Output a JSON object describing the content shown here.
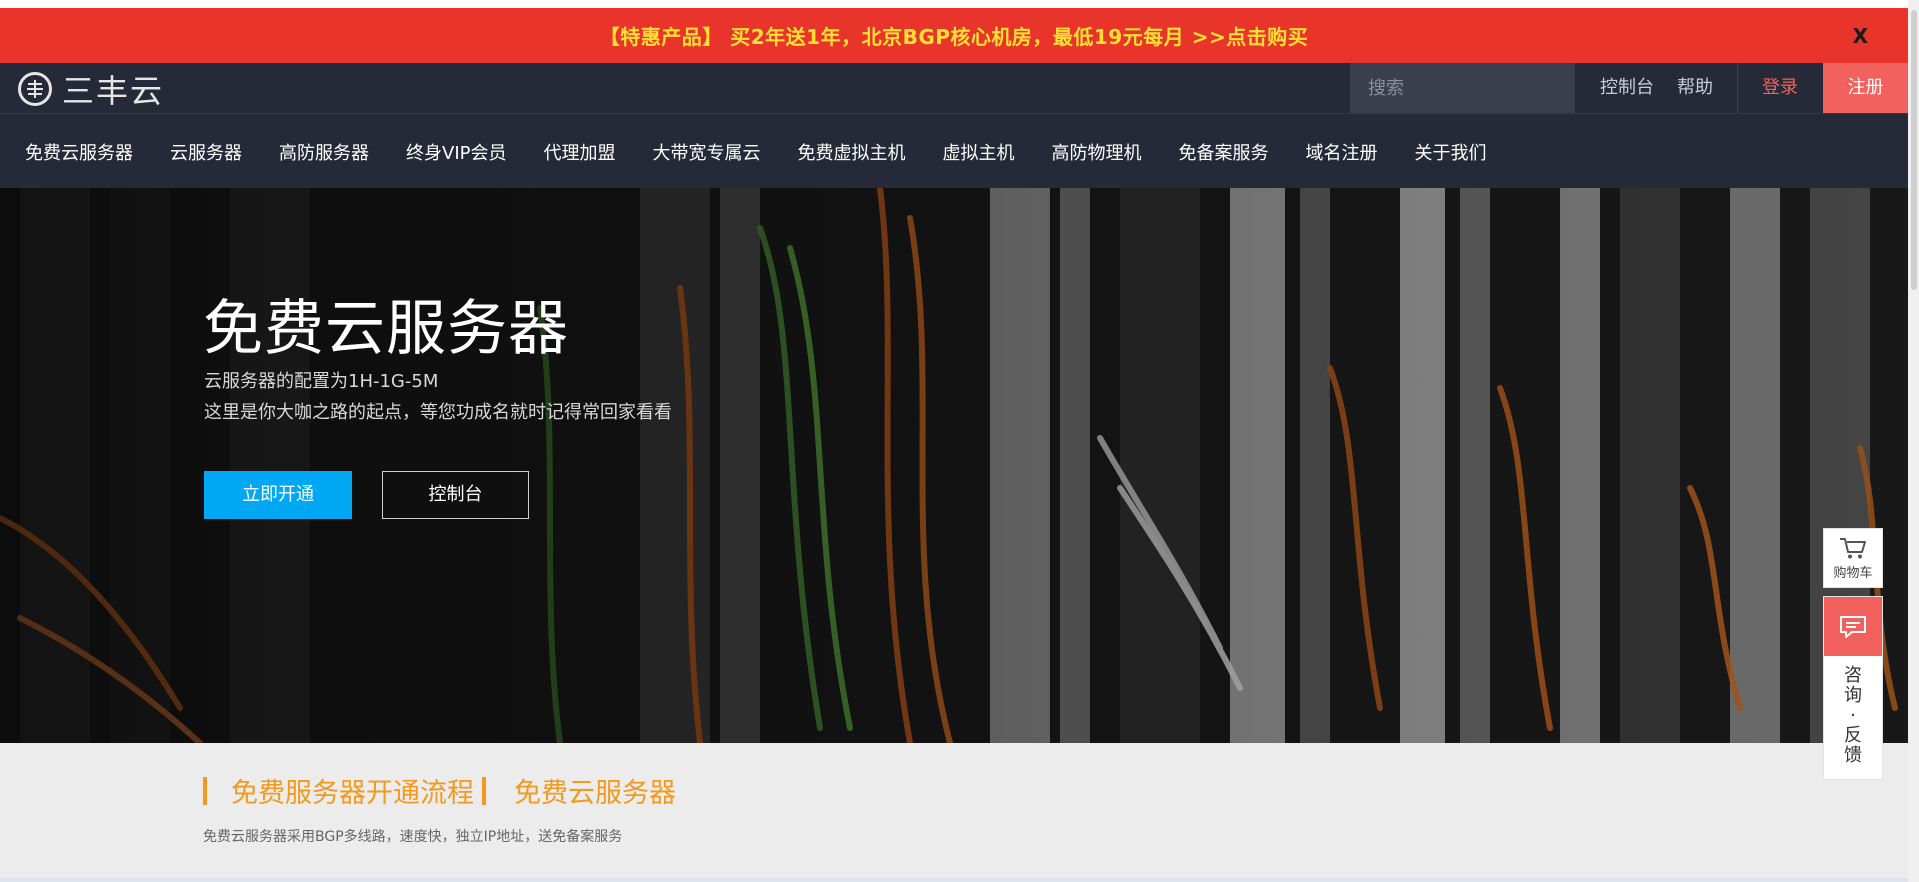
{
  "promo": {
    "text": "【特惠产品】 买2年送1年，北京BGP核心机房，最低19元每月 >>点击购买",
    "close": "X"
  },
  "header": {
    "logo_text": "三丰云",
    "search_placeholder": "搜索",
    "console": "控制台",
    "help": "帮助",
    "login": "登录",
    "register": "注册"
  },
  "nav": {
    "items": [
      "免费云服务器",
      "云服务器",
      "高防服务器",
      "终身VIP会员",
      "代理加盟",
      "大带宽专属云",
      "免费虚拟主机",
      "虚拟主机",
      "高防物理机",
      "免备案服务",
      "域名注册",
      "关于我们"
    ]
  },
  "hero": {
    "title": "免费云服务器",
    "line1": "云服务器的配置为1H-1G-5M",
    "line2": "这里是你大咖之路的起点，等您功成名就时记得常回家看看",
    "primary_button": "立即开通",
    "secondary_button": "控制台"
  },
  "section": {
    "title": "免费服务器开通流程",
    "title2": "免费云服务器",
    "desc": "免费云服务器采用BGP多线路，速度快，独立IP地址，送免备案服务"
  },
  "float": {
    "cart_label": "购物车",
    "consult": [
      "咨",
      "询",
      "·",
      "反",
      "馈"
    ]
  },
  "colors": {
    "promo_bg": "#e8342a",
    "promo_text": "#ffe033",
    "header_bg": "#262a38",
    "accent_red": "#f3615e",
    "accent_blue": "#00a8f3",
    "accent_orange": "#f39a1e"
  },
  "icons": {
    "search": "search-icon",
    "cart": "cart-icon",
    "chat": "chat-icon"
  }
}
